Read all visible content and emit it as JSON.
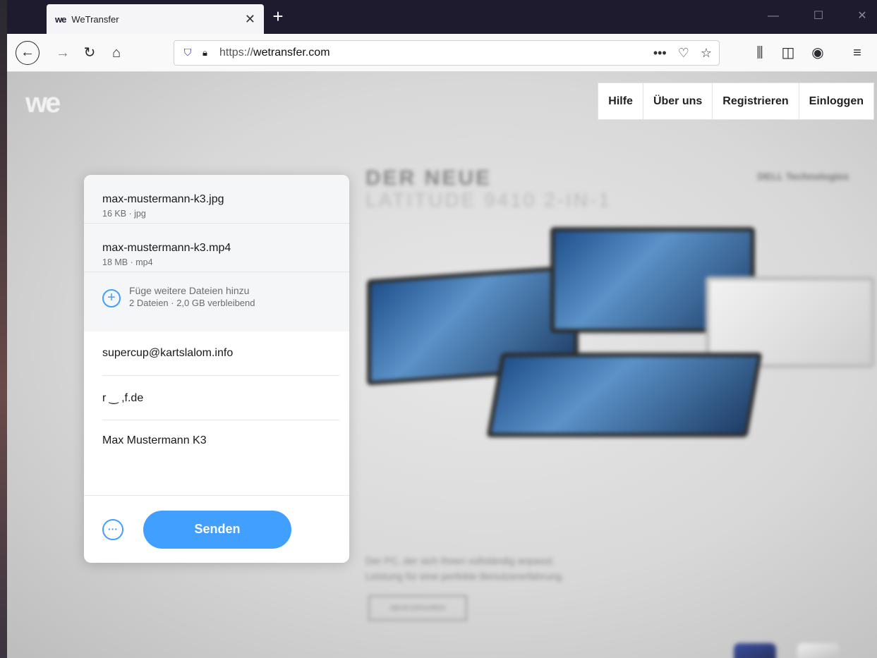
{
  "browser": {
    "tab": {
      "logo": "we",
      "title": "WeTransfer",
      "close": "✕"
    },
    "new_tab": "+",
    "window_controls": {
      "minimize": "—",
      "maximize": "☐",
      "close": "✕"
    },
    "url": {
      "scheme": "https://",
      "host": "wetransfer.com"
    },
    "url_actions": {
      "more": "•••",
      "pocket": "♡",
      "bookmark": "☆"
    }
  },
  "site": {
    "logo": "we",
    "nav": [
      "Hilfe",
      "Über uns",
      "Registrieren",
      "Einloggen"
    ]
  },
  "transfer": {
    "files": [
      {
        "name": "max-mustermann-k3.jpg",
        "meta": "16 KB · jpg"
      },
      {
        "name": "max-mustermann-k3.mp4",
        "meta": "18 MB · mp4"
      }
    ],
    "add_more": {
      "title": "Füge weitere Dateien hinzu",
      "meta": "2 Dateien · 2,0 GB verbleibend"
    },
    "email_to": "supercup@kartslalom.info",
    "email_from": "r  ‿  ,f.de",
    "message": "Max Mustermann K3",
    "more_button": "···",
    "send_label": "Senden"
  },
  "ad": {
    "headline1": "DER NEUE",
    "headline2": "LATITUDE 9410 2-IN-1",
    "brand": "DELL Technologies",
    "copy1": "Der PC, der sich Ihnen vollständig anpasst.",
    "copy2": "Leistung für eine perfekte Benutzererfahrung.",
    "cta": "MEHR ERFAHREN"
  },
  "colors": {
    "accent": "#409fff",
    "tabbar": "#1e1b2f"
  }
}
